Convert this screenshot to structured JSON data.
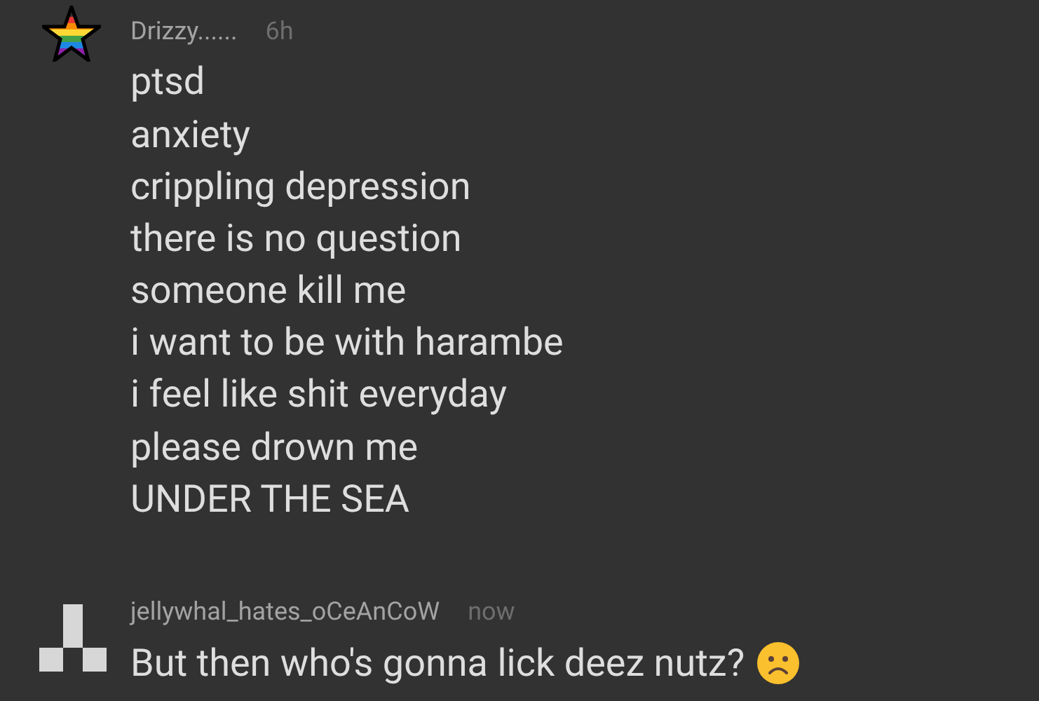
{
  "comments": [
    {
      "kind": "star",
      "author": "Drizzy......",
      "time": "6h",
      "lines": [
        "ptsd",
        "anxiety",
        "crippling depression",
        "there is no question",
        "someone kill me",
        "i want to be with harambe",
        "i feel like shit everyday",
        "please drown me",
        "UNDER THE SEA"
      ],
      "emoji": false
    },
    {
      "kind": "blocks",
      "author": "jellywhal_hates_oCeAnCoW",
      "time": "now",
      "lines": [
        "But then who's gonna lick deez nutz?"
      ],
      "emoji": true
    }
  ]
}
